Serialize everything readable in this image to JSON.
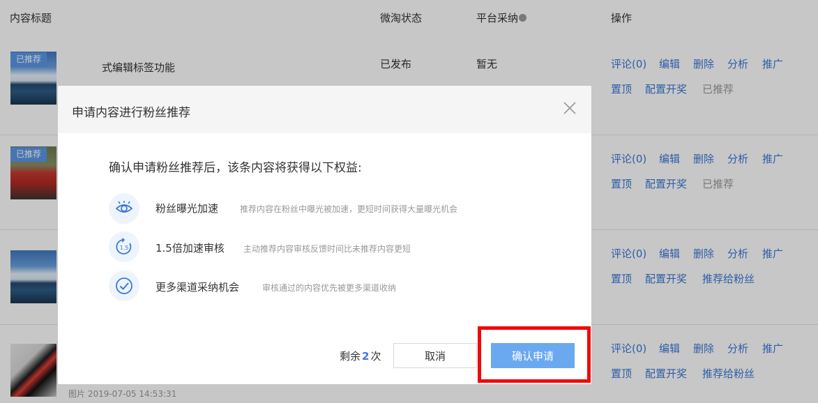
{
  "table": {
    "headers": {
      "title": "内容标题",
      "status": "微淘状态",
      "platform": "平台采纳",
      "actions": "操作"
    },
    "rows": [
      {
        "badge": "已推荐",
        "title": "式编辑标签功能",
        "status": "已发布",
        "platform": "暂无",
        "actions_line1": [
          "评论(0)",
          "编辑",
          "删除",
          "分析",
          "推广"
        ],
        "actions_line2": [
          "置顶",
          "配置开奖",
          "已推荐"
        ]
      },
      {
        "badge": "已推荐",
        "actions_line1": [
          "评论(0)",
          "编辑",
          "删除",
          "分析",
          "推广"
        ],
        "actions_line2": [
          "置顶",
          "配置开奖",
          "已推荐"
        ]
      },
      {
        "actions_line1": [
          "评论(0)",
          "编辑",
          "删除",
          "分析",
          "推广"
        ],
        "actions_line2": [
          "置顶",
          "配置开奖",
          "推荐给粉丝"
        ]
      },
      {
        "meta": "图片 2019-07-05 14:53:31",
        "actions_line1": [
          "评论(0)",
          "编辑",
          "删除",
          "分析",
          "推广"
        ],
        "actions_line2": [
          "置顶",
          "配置开奖",
          "推荐给粉丝"
        ]
      }
    ]
  },
  "modal": {
    "title": "申请内容进行粉丝推荐",
    "lead": "确认申请粉丝推荐后，该条内容将获得以下权益:",
    "benefits": [
      {
        "icon": "eye-icon",
        "name": "粉丝曝光加速",
        "desc": "推荐内容在粉丝中曝光被加速，更短时间获得大量曝光机会"
      },
      {
        "icon": "speed-1.5-icon",
        "name": "1.5倍加速审核",
        "desc": "主动推荐内容审核反馈时间比未推荐内容更短"
      },
      {
        "icon": "check-circle-icon",
        "name": "更多渠道采纳机会",
        "desc": "审核通过的内容优先被更多渠道收纳"
      }
    ],
    "remaining_prefix": "剩余",
    "remaining_count": "2",
    "remaining_suffix": "次",
    "cancel_label": "取消",
    "confirm_label": "确认申请"
  },
  "colors": {
    "link": "#3b78d8",
    "badge": "#5b97e6",
    "confirm_button": "#6aa9f0",
    "highlight": "#f00a0a"
  }
}
